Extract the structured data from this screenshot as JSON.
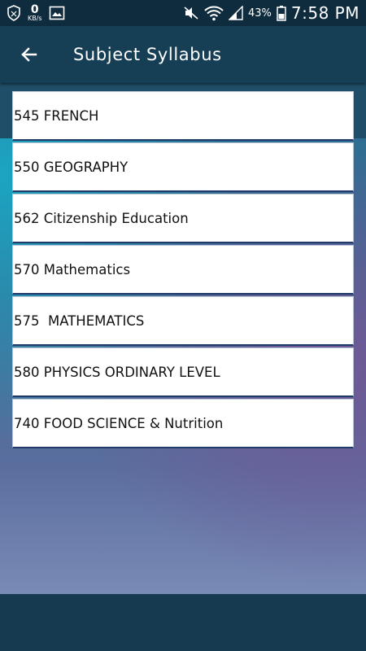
{
  "status_bar": {
    "network_speed_value": "0",
    "network_speed_unit": "KB/s",
    "battery_percent": "43%",
    "time": "7:58 PM"
  },
  "app_bar": {
    "title": "Subject Syllabus"
  },
  "subjects": [
    "545 FRENCH",
    "550 GEOGRAPHY",
    "562 Citizenship Education",
    "570 Mathematics",
    "575  MATHEMATICS",
    "580 PHYSICS ORDINARY LEVEL",
    "740 FOOD SCIENCE & Nutrition"
  ],
  "colors": {
    "status_bar": "#0f2c3e",
    "app_bar": "#163e54",
    "accent_teal": "#1aa8c4",
    "accent_purple": "#745696"
  }
}
